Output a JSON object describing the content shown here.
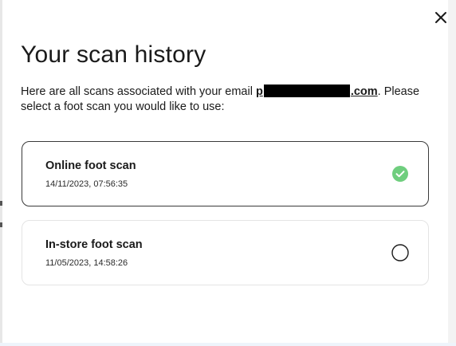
{
  "modal": {
    "title": "Your scan history",
    "intro_before": "Here are all scans associated with your email ",
    "email_start": "p",
    "email_end": ".com",
    "intro_after": ". Please select a foot scan you would like to use:"
  },
  "icons": {
    "close": "close-icon",
    "selected": "check-circle-icon",
    "unselected": "radio-empty-icon"
  },
  "colors": {
    "check_green": "#6fce7e",
    "selected_border": "#3a3a3a",
    "unselected_border": "#e4e4e4"
  },
  "scans": [
    {
      "title": "Online foot scan",
      "date": "14/11/2023, 07:56:35",
      "selected": true
    },
    {
      "title": "In-store foot scan",
      "date": "11/05/2023, 14:58:26",
      "selected": false
    }
  ]
}
